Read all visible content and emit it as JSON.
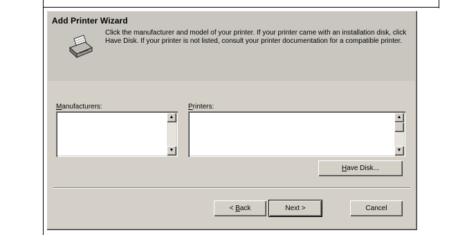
{
  "window": {
    "title": "Add Printer Wizard"
  },
  "header": {
    "icon": "printer-icon",
    "instructions": "Click the manufacturer and model of your printer. If your printer came with an installation disk, click Have Disk. If your printer is not listed, consult your printer documentation for a compatible printer."
  },
  "manufacturers": {
    "label_accel": "M",
    "label_rest": "anufacturers:",
    "items": []
  },
  "printers": {
    "label_accel": "P",
    "label_rest": "rinters:",
    "items": []
  },
  "buttons": {
    "have_disk_accel": "H",
    "have_disk_rest": "ave Disk...",
    "back_prefix": "< ",
    "back_accel": "B",
    "back_rest": "ack",
    "next": "Next >",
    "cancel": "Cancel"
  },
  "colors": {
    "dialog_face": "#d4d0c8",
    "listbox_bg": "#ffffff"
  }
}
